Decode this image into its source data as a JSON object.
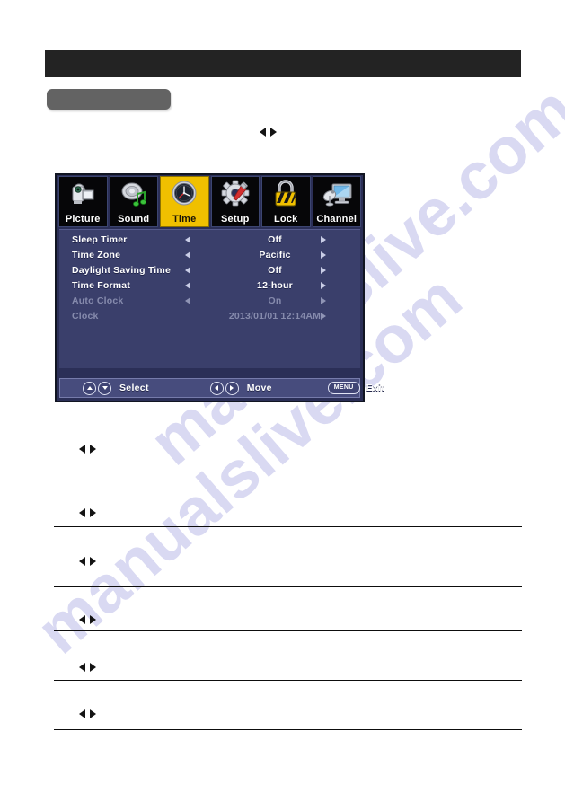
{
  "page": {
    "watermark_line1": "manualslive.com",
    "watermark_line2": "manualslive.com"
  },
  "osd": {
    "tabs": [
      {
        "label": "Picture",
        "icon": "camcorder-icon",
        "active": false
      },
      {
        "label": "Sound",
        "icon": "speaker-music-note-icon",
        "active": false
      },
      {
        "label": "Time",
        "icon": "analog-clock-icon",
        "active": true
      },
      {
        "label": "Setup",
        "icon": "gear-screwdriver-icon",
        "active": false
      },
      {
        "label": "Lock",
        "icon": "padlock-icon",
        "active": false
      },
      {
        "label": "Channel",
        "icon": "satellite-monitor-icon",
        "active": false
      }
    ],
    "rows": [
      {
        "label": "Sleep Timer",
        "value": "Off",
        "dim": false,
        "left_arrow": true
      },
      {
        "label": "Time Zone",
        "value": "Pacific",
        "dim": false,
        "left_arrow": true
      },
      {
        "label": "Daylight Saving Time",
        "value": "Off",
        "dim": false,
        "left_arrow": true
      },
      {
        "label": "Time Format",
        "value": "12-hour",
        "dim": false,
        "left_arrow": true
      },
      {
        "label": "Auto Clock",
        "value": "On",
        "dim": true,
        "left_arrow": true
      },
      {
        "label": "Clock",
        "value": "2013/01/01 12:14AM",
        "dim": true,
        "left_arrow": false
      }
    ],
    "footer": {
      "select_label": "Select",
      "move_label": "Move",
      "exit_label": "Exit",
      "menu_key_label": "MENU"
    }
  },
  "colors": {
    "header_bar": "#232323",
    "gray_chip": "#636363",
    "osd_panel": "#2b2f57",
    "osd_list": "#3a3f6b",
    "osd_footer": "#474c7d",
    "active_tab": "#f0c000",
    "dim_text": "#868bad",
    "watermark": "#d9d9f2"
  }
}
